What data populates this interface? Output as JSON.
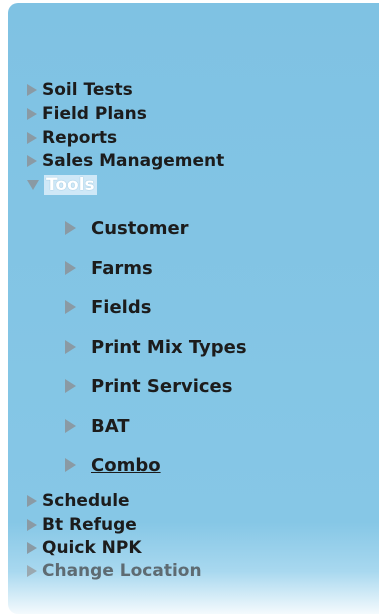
{
  "menu": {
    "items": [
      {
        "label": "Soil Tests"
      },
      {
        "label": "Field Plans"
      },
      {
        "label": "Reports"
      },
      {
        "label": "Sales Management"
      },
      {
        "label": "Tools",
        "expanded": true,
        "selected": true
      },
      {
        "label": "Schedule"
      },
      {
        "label": "Bt Refuge"
      },
      {
        "label": "Quick NPK"
      },
      {
        "label": "Change Location"
      }
    ],
    "tools_subitems": [
      {
        "label": "Customer"
      },
      {
        "label": "Farms"
      },
      {
        "label": "Fields"
      },
      {
        "label": "Print Mix Types"
      },
      {
        "label": "Print Services"
      },
      {
        "label": "BAT"
      },
      {
        "label": "Combo",
        "hovered": true
      }
    ]
  },
  "icons": {
    "collapsed": "triangle-right-icon",
    "expanded": "triangle-down-icon"
  },
  "colors": {
    "panel_bg": "#7fc2e3",
    "text": "#1c1c1c",
    "arrow": "#8a9aa4",
    "selected_text": "#ffffff"
  }
}
